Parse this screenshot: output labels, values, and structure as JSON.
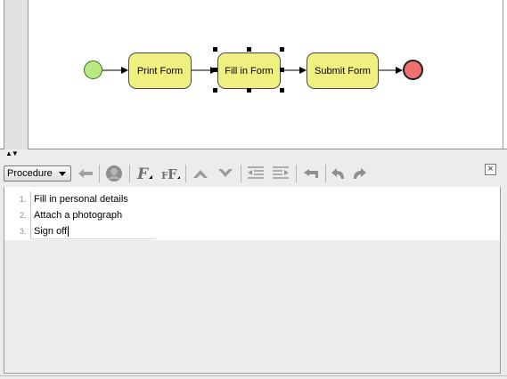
{
  "diagram": {
    "nodes": [
      {
        "label": "Print Form"
      },
      {
        "label": "Fill in Form"
      },
      {
        "label": "Submit Form"
      }
    ],
    "colors": {
      "task_fill": "#f0f080",
      "start_fill": "#b8ea80",
      "end_fill": "#f07070"
    }
  },
  "splitter": {
    "arrows": "▲▼"
  },
  "toolbar": {
    "procedure_select": "Procedure",
    "icons": [
      "back-arrow-icon",
      "user-icon",
      "font-icon",
      "font-size-icon",
      "move-up-icon",
      "move-down-icon",
      "outdent-icon",
      "indent-icon",
      "return-icon",
      "undo-icon",
      "redo-icon"
    ],
    "close_label": "×"
  },
  "editor": {
    "steps": [
      {
        "number": "1.",
        "text": "Fill in personal details"
      },
      {
        "number": "2.",
        "text": "Attach a photograph"
      },
      {
        "number": "3.",
        "text": "Sign off"
      }
    ]
  }
}
